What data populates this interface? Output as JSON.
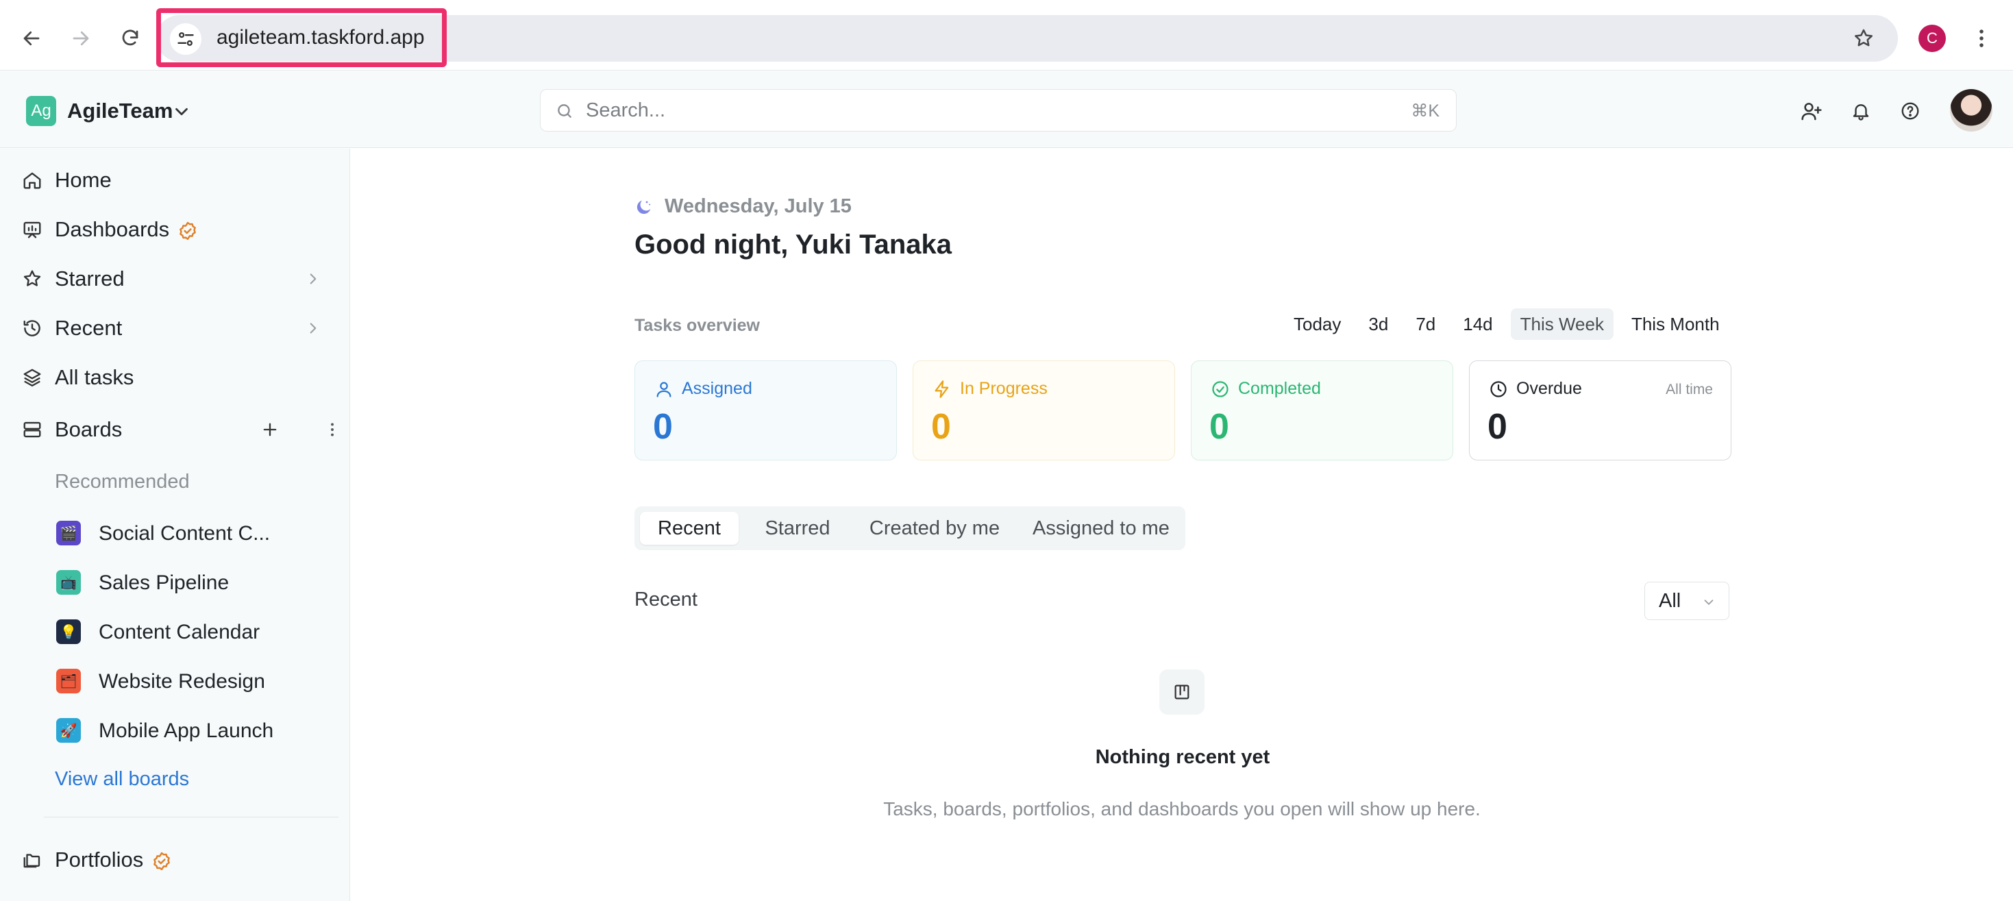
{
  "browser": {
    "url": "agileteam.taskford.app",
    "profile_initial": "C"
  },
  "header": {
    "workspace_logo": "Ag",
    "workspace_name": "AgileTeam",
    "search_placeholder": "Search...",
    "search_shortcut": "⌘K"
  },
  "sidebar": {
    "items": [
      {
        "label": "Home"
      },
      {
        "label": "Dashboards"
      },
      {
        "label": "Starred"
      },
      {
        "label": "Recent"
      },
      {
        "label": "All tasks"
      },
      {
        "label": "Boards"
      }
    ],
    "recommended_title": "Recommended",
    "boards": [
      {
        "label": "Social Content C...",
        "icon": "🎬"
      },
      {
        "label": "Sales Pipeline",
        "icon": "📺"
      },
      {
        "label": "Content Calendar",
        "icon": "💡"
      },
      {
        "label": "Website Redesign",
        "icon": "🗂"
      },
      {
        "label": "Mobile App Launch",
        "icon": "🚀"
      }
    ],
    "view_all": "View all boards",
    "portfolios": "Portfolios"
  },
  "main": {
    "date": "Wednesday, July 15",
    "greeting": "Good night, Yuki Tanaka",
    "overview_label": "Tasks overview",
    "ranges": [
      "Today",
      "3d",
      "7d",
      "14d",
      "This Week",
      "This Month"
    ],
    "active_range": "This Week",
    "stats": [
      {
        "label": "Assigned",
        "value": "0",
        "color": "#2b77d4"
      },
      {
        "label": "In Progress",
        "value": "0",
        "color": "#e8a317"
      },
      {
        "label": "Completed",
        "value": "0",
        "color": "#2bb673"
      },
      {
        "label": "Overdue",
        "value": "0",
        "aside": "All time",
        "color": "#1f2328"
      }
    ],
    "filter_tabs": [
      "Recent",
      "Starred",
      "Created by me",
      "Assigned to me"
    ],
    "active_filter": "Recent",
    "recent_label": "Recent",
    "recent_filter": "All",
    "empty_title": "Nothing recent yet",
    "empty_subtitle": "Tasks, boards, portfolios, and dashboards you open will show up here."
  }
}
